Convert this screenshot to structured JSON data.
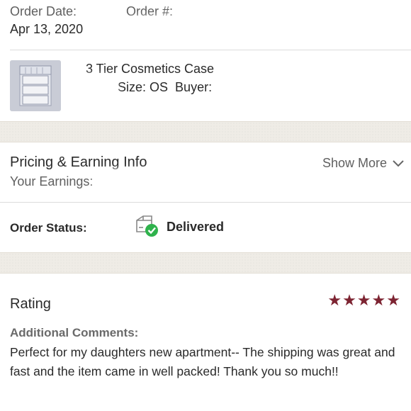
{
  "order": {
    "date_label": "Order Date:",
    "date_value": "Apr 13, 2020",
    "number_label": "Order #:"
  },
  "item": {
    "title": "3 Tier Cosmetics Case",
    "size_text": "Size: OS",
    "buyer_label": "Buyer:"
  },
  "pricing": {
    "title": "Pricing & Earning Info",
    "earnings_label": "Your Earnings:",
    "show_more": "Show More"
  },
  "status": {
    "label": "Order Status:",
    "value": "Delivered"
  },
  "rating": {
    "title": "Rating",
    "stars": 5,
    "star_color": "#7d2432",
    "comments_label": "Additional Comments:",
    "comment": "Perfect for my daughters new apartment-- The shipping was great and fast and the item came in well packed! Thank you so much!!"
  },
  "colors": {
    "delivered_check": "#2fb24c",
    "divider_band": "#efece6"
  }
}
